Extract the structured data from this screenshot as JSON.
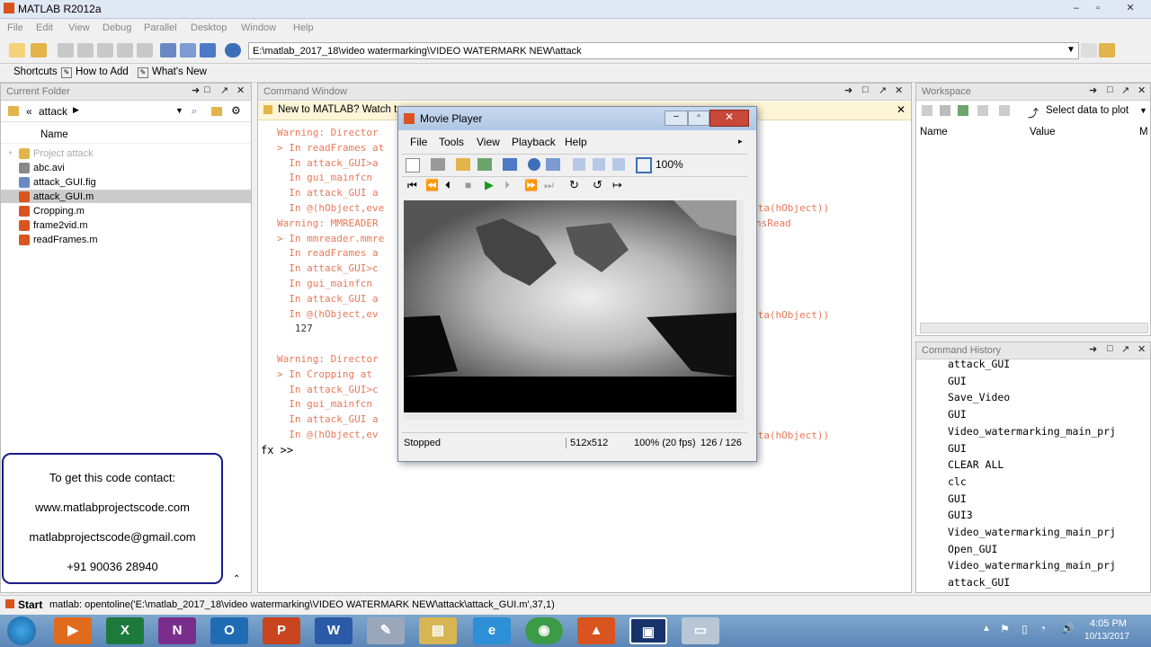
{
  "window": {
    "title": "MATLAB  R2012a"
  },
  "menubar": [
    "File",
    "Edit",
    "View",
    "Debug",
    "Parallel",
    "Desktop",
    "Window",
    "Help"
  ],
  "toolbar": {
    "path": "E:\\matlab_2017_18\\video watermarking\\VIDEO WATERMARK NEW\\attack"
  },
  "shortcuts": {
    "shortcuts": "Shortcuts",
    "how_to_add": "How to Add",
    "whats_new": "What's New"
  },
  "current_folder": {
    "title": "Current Folder",
    "location": "attack",
    "column": "Name",
    "items": [
      {
        "name": "Project attack",
        "icon": "folder-icon"
      },
      {
        "name": "abc.avi",
        "icon": "video-file-icon"
      },
      {
        "name": "attack_GUI.fig",
        "icon": "fig-file-icon"
      },
      {
        "name": "attack_GUI.m",
        "icon": "m-file-icon"
      },
      {
        "name": "Cropping.m",
        "icon": "m-file-icon"
      },
      {
        "name": "frame2vid.m",
        "icon": "m-file-icon"
      },
      {
        "name": "readFrames.m",
        "icon": "m-file-icon"
      }
    ]
  },
  "command_window": {
    "title": "Command Window",
    "banner": "New to MATLAB? Watch t",
    "prompt": "fx >>",
    "lines": [
      "Warning: Director",
      "> In readFrames at",
      "  In attack_GUI>a",
      "  In gui_mainfcn",
      "  In attack_GUI a",
      "  In @(hObject,eve",
      "Warning: MMREADER",
      "> In mmreader.mmre",
      "  In readFrames a",
      "  In attack_GUI>c",
      "  In gui_mainfcn",
      "  In attack_GUI a",
      "  In @(hObject,ev",
      "   127",
      "",
      "Warning: Director",
      "> In Cropping at",
      "  In attack_GUI>c",
      "  In gui_mainfcn",
      "  In attack_GUI a",
      "  In @(hObject,ev"
    ],
    "right_fragments": [
      "ata(hObject))",
      "nsRead",
      "ata(hObject))",
      "ata(hObject))"
    ]
  },
  "workspace": {
    "title": "Workspace",
    "select_data": "Select data to plot",
    "col_name": "Name",
    "col_value": "Value",
    "col_m": "M"
  },
  "command_history": {
    "title": "Command History",
    "items": [
      "attack_GUI",
      "GUI",
      "Save_Video",
      "GUI",
      "Video_watermarking_main_prj",
      "GUI",
      "CLEAR ALL",
      "clc",
      "GUI",
      "GUI3",
      "Video_watermarking_main_prj",
      "Open_GUI",
      "Video_watermarking_main_prj",
      "attack_GUI"
    ]
  },
  "movie_player": {
    "title": "Movie Player",
    "menu": [
      "File",
      "Tools",
      "View",
      "Playback",
      "Help"
    ],
    "zoom": "100%",
    "status": "Stopped",
    "size": "512x512",
    "fps": "100% (20 fps)",
    "frame": "126 / 126"
  },
  "contact": {
    "heading": "To get this code contact:",
    "website": "www.matlabprojectscode.com",
    "email": "matlabprojectscode@gmail.com",
    "phone": "+91 90036 28940"
  },
  "statusbar": {
    "start": "Start",
    "text": "matlab: opentoline('E:\\matlab_2017_18\\video watermarking\\VIDEO WATERMARK NEW\\attack\\attack_GUI.m',37,1)"
  },
  "taskbar": {
    "apps": [
      "windows-start",
      "media-player",
      "excel",
      "onenote",
      "outlook",
      "powerpoint",
      "word",
      "paint",
      "file-explorer",
      "internet-explorer",
      "chrome",
      "matlab",
      "matlab-figure",
      "notepad"
    ],
    "time": "4:05 PM",
    "date": "10/13/2017"
  }
}
